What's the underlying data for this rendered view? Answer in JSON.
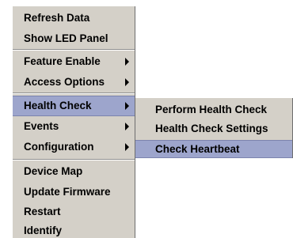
{
  "main_menu": {
    "items": [
      {
        "label": "Refresh Data"
      },
      {
        "label": "Show LED Panel"
      },
      {
        "label": "Feature Enable"
      },
      {
        "label": "Access Options"
      },
      {
        "label": "Health Check"
      },
      {
        "label": "Events"
      },
      {
        "label": "Configuration"
      },
      {
        "label": "Device Map"
      },
      {
        "label": "Update Firmware"
      },
      {
        "label": "Restart"
      },
      {
        "label": "Identify"
      }
    ],
    "arrow_icon": "submenu-arrow-icon"
  },
  "sub_menu": {
    "items": [
      {
        "label": "Perform Health Check"
      },
      {
        "label": "Health Check Settings"
      },
      {
        "label": "Check Heartbeat"
      }
    ]
  },
  "colors": {
    "menu_background": "#d4d0c8",
    "highlight": "#9da5cc"
  }
}
